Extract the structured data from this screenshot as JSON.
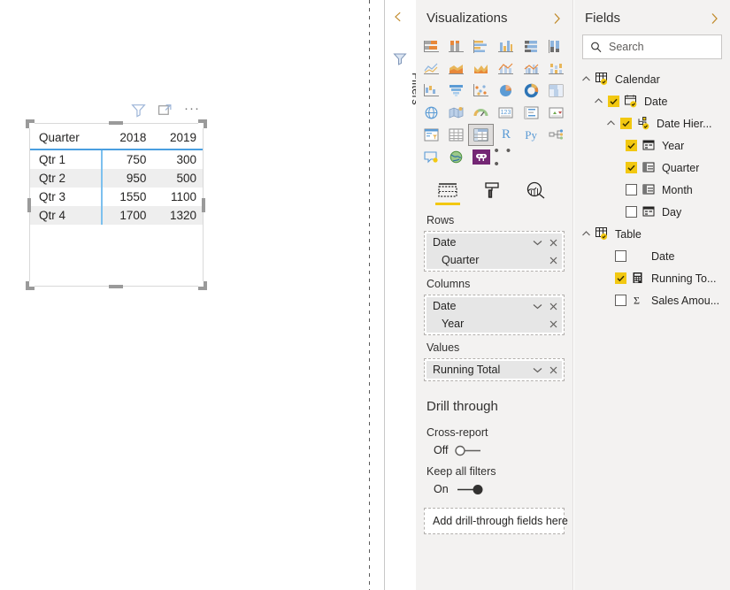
{
  "canvas": {
    "visual_header": {
      "filter_icon": "filter-icon",
      "focus_icon": "focus-mode-icon",
      "more_label": "···"
    },
    "matrix": {
      "row_header": "Quarter",
      "columns": [
        "2018",
        "2019"
      ],
      "rows": [
        {
          "label": "Qtr 1",
          "values": [
            "750",
            "300"
          ]
        },
        {
          "label": "Qtr 2",
          "values": [
            "950",
            "500"
          ]
        },
        {
          "label": "Qtr 3",
          "values": [
            "1550",
            "1100"
          ]
        },
        {
          "label": "Qtr 4",
          "values": [
            "1700",
            "1320"
          ]
        }
      ]
    }
  },
  "filters_rail": {
    "collapse_icon": "chevron-left-icon",
    "filter_icon": "filter-icon",
    "label": "Filters"
  },
  "visualizations": {
    "title": "Visualizations",
    "expand_icon": "chevron-right-icon",
    "icons": [
      "stacked-bar-chart-icon",
      "stacked-column-chart-icon",
      "clustered-bar-chart-icon",
      "clustered-column-chart-icon",
      "hundred-percent-stacked-bar-chart-icon",
      "hundred-percent-stacked-column-chart-icon",
      "line-chart-icon",
      "stacked-area-chart-icon",
      "area-chart-icon",
      "line-stacked-column-chart-icon",
      "line-clustered-column-chart-icon",
      "ribbon-chart-icon",
      "waterfall-chart-icon",
      "funnel-chart-icon",
      "scatter-chart-icon",
      "pie-chart-icon",
      "donut-chart-icon",
      "treemap-icon",
      "map-icon",
      "filled-map-icon",
      "gauge-icon",
      "card-icon",
      "multi-row-card-icon",
      "kpi-icon",
      "slicer-icon",
      "table-icon",
      "matrix-icon",
      "r-script-visual-icon",
      "python-visual-icon",
      "decomposition-tree-icon",
      "key-influencers-icon",
      "arcgis-map-icon",
      "power-apps-icon",
      "more-visuals-icon"
    ],
    "selected_icon": "matrix-icon",
    "more_label": "• • •",
    "tabs": [
      {
        "label": "Fields",
        "icon": "fields-tab-icon",
        "active": true
      },
      {
        "label": "Format",
        "icon": "format-paint-roller-icon",
        "active": false
      },
      {
        "label": "Analytics",
        "icon": "analytics-magnifier-icon",
        "active": false
      }
    ],
    "wells": [
      {
        "label": "Rows",
        "chips": [
          {
            "text": "Date",
            "has_chevron": true,
            "child": false
          },
          {
            "text": "Quarter",
            "has_chevron": false,
            "child": true
          }
        ]
      },
      {
        "label": "Columns",
        "chips": [
          {
            "text": "Date",
            "has_chevron": true,
            "child": false
          },
          {
            "text": "Year",
            "has_chevron": false,
            "child": true
          }
        ]
      },
      {
        "label": "Values",
        "chips": [
          {
            "text": "Running Total",
            "has_chevron": true,
            "child": false
          }
        ]
      }
    ],
    "drill_through": {
      "title": "Drill through",
      "cross_report": {
        "label": "Cross-report",
        "state": "Off",
        "on": false
      },
      "keep_all_filters": {
        "label": "Keep all filters",
        "state": "On",
        "on": true
      },
      "drop_zone": "Add drill-through fields here"
    }
  },
  "fields": {
    "title": "Fields",
    "expand_icon": "chevron-right-icon",
    "search": {
      "placeholder": "Search",
      "icon": "search-icon"
    },
    "tree": [
      {
        "text": "Calendar",
        "indent": 0,
        "chevron": "down",
        "checkbox": "none",
        "icon": "table-badge-icon"
      },
      {
        "text": "Date",
        "indent": 1,
        "chevron": "down",
        "checkbox": "checked",
        "icon": "calendar-badge-icon"
      },
      {
        "text": "Date Hier...",
        "indent": 2,
        "chevron": "down",
        "checkbox": "checked",
        "icon": "hierarchy-badge-icon"
      },
      {
        "text": "Year",
        "indent": 3,
        "chevron": "none",
        "checkbox": "checked",
        "icon": "date-field-icon"
      },
      {
        "text": "Quarter",
        "indent": 3,
        "chevron": "none",
        "checkbox": "checked",
        "icon": "date-field-icon"
      },
      {
        "text": "Month",
        "indent": 3,
        "chevron": "none",
        "checkbox": "unchecked",
        "icon": "date-field-icon"
      },
      {
        "text": "Day",
        "indent": 3,
        "chevron": "none",
        "checkbox": "unchecked",
        "icon": "date-field-icon"
      },
      {
        "text": "Table",
        "indent": 0,
        "chevron": "down",
        "checkbox": "none",
        "icon": "table-badge-icon"
      },
      {
        "text": "Date",
        "indent": 4,
        "chevron": "none",
        "checkbox": "unchecked",
        "icon": "none"
      },
      {
        "text": "Running To...",
        "indent": 4,
        "chevron": "none",
        "checkbox": "checked",
        "icon": "measure-calculator-icon"
      },
      {
        "text": "Sales Amou...",
        "indent": 4,
        "chevron": "none",
        "checkbox": "unchecked",
        "icon": "sigma-icon"
      }
    ]
  },
  "colors": {
    "accent_yellow": "#f2c811",
    "matrix_rule_blue": "#4a9fe0",
    "pane_bg": "#f3f2f1",
    "alt_row": "#eeeeee"
  }
}
